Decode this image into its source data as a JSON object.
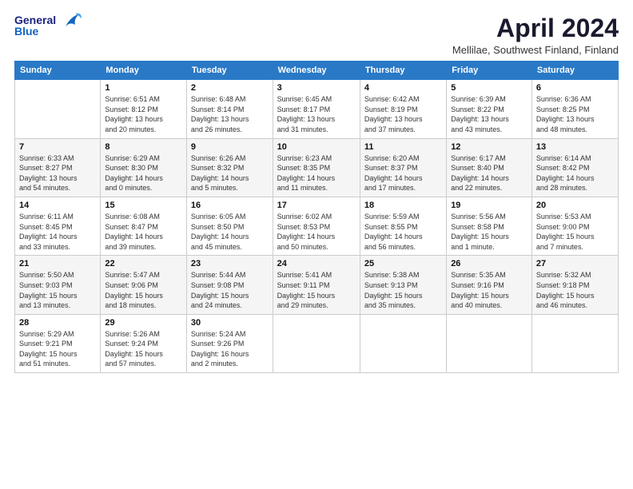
{
  "header": {
    "logo_general": "General",
    "logo_blue": "Blue",
    "month_title": "April 2024",
    "subtitle": "Mellilae, Southwest Finland, Finland"
  },
  "weekdays": [
    "Sunday",
    "Monday",
    "Tuesday",
    "Wednesday",
    "Thursday",
    "Friday",
    "Saturday"
  ],
  "weeks": [
    [
      {
        "day": "",
        "sunrise": "",
        "sunset": "",
        "daylight": ""
      },
      {
        "day": "1",
        "sunrise": "Sunrise: 6:51 AM",
        "sunset": "Sunset: 8:12 PM",
        "daylight": "Daylight: 13 hours and 20 minutes."
      },
      {
        "day": "2",
        "sunrise": "Sunrise: 6:48 AM",
        "sunset": "Sunset: 8:14 PM",
        "daylight": "Daylight: 13 hours and 26 minutes."
      },
      {
        "day": "3",
        "sunrise": "Sunrise: 6:45 AM",
        "sunset": "Sunset: 8:17 PM",
        "daylight": "Daylight: 13 hours and 31 minutes."
      },
      {
        "day": "4",
        "sunrise": "Sunrise: 6:42 AM",
        "sunset": "Sunset: 8:19 PM",
        "daylight": "Daylight: 13 hours and 37 minutes."
      },
      {
        "day": "5",
        "sunrise": "Sunrise: 6:39 AM",
        "sunset": "Sunset: 8:22 PM",
        "daylight": "Daylight: 13 hours and 43 minutes."
      },
      {
        "day": "6",
        "sunrise": "Sunrise: 6:36 AM",
        "sunset": "Sunset: 8:25 PM",
        "daylight": "Daylight: 13 hours and 48 minutes."
      }
    ],
    [
      {
        "day": "7",
        "sunrise": "Sunrise: 6:33 AM",
        "sunset": "Sunset: 8:27 PM",
        "daylight": "Daylight: 13 hours and 54 minutes."
      },
      {
        "day": "8",
        "sunrise": "Sunrise: 6:29 AM",
        "sunset": "Sunset: 8:30 PM",
        "daylight": "Daylight: 14 hours and 0 minutes."
      },
      {
        "day": "9",
        "sunrise": "Sunrise: 6:26 AM",
        "sunset": "Sunset: 8:32 PM",
        "daylight": "Daylight: 14 hours and 5 minutes."
      },
      {
        "day": "10",
        "sunrise": "Sunrise: 6:23 AM",
        "sunset": "Sunset: 8:35 PM",
        "daylight": "Daylight: 14 hours and 11 minutes."
      },
      {
        "day": "11",
        "sunrise": "Sunrise: 6:20 AM",
        "sunset": "Sunset: 8:37 PM",
        "daylight": "Daylight: 14 hours and 17 minutes."
      },
      {
        "day": "12",
        "sunrise": "Sunrise: 6:17 AM",
        "sunset": "Sunset: 8:40 PM",
        "daylight": "Daylight: 14 hours and 22 minutes."
      },
      {
        "day": "13",
        "sunrise": "Sunrise: 6:14 AM",
        "sunset": "Sunset: 8:42 PM",
        "daylight": "Daylight: 14 hours and 28 minutes."
      }
    ],
    [
      {
        "day": "14",
        "sunrise": "Sunrise: 6:11 AM",
        "sunset": "Sunset: 8:45 PM",
        "daylight": "Daylight: 14 hours and 33 minutes."
      },
      {
        "day": "15",
        "sunrise": "Sunrise: 6:08 AM",
        "sunset": "Sunset: 8:47 PM",
        "daylight": "Daylight: 14 hours and 39 minutes."
      },
      {
        "day": "16",
        "sunrise": "Sunrise: 6:05 AM",
        "sunset": "Sunset: 8:50 PM",
        "daylight": "Daylight: 14 hours and 45 minutes."
      },
      {
        "day": "17",
        "sunrise": "Sunrise: 6:02 AM",
        "sunset": "Sunset: 8:53 PM",
        "daylight": "Daylight: 14 hours and 50 minutes."
      },
      {
        "day": "18",
        "sunrise": "Sunrise: 5:59 AM",
        "sunset": "Sunset: 8:55 PM",
        "daylight": "Daylight: 14 hours and 56 minutes."
      },
      {
        "day": "19",
        "sunrise": "Sunrise: 5:56 AM",
        "sunset": "Sunset: 8:58 PM",
        "daylight": "Daylight: 15 hours and 1 minute."
      },
      {
        "day": "20",
        "sunrise": "Sunrise: 5:53 AM",
        "sunset": "Sunset: 9:00 PM",
        "daylight": "Daylight: 15 hours and 7 minutes."
      }
    ],
    [
      {
        "day": "21",
        "sunrise": "Sunrise: 5:50 AM",
        "sunset": "Sunset: 9:03 PM",
        "daylight": "Daylight: 15 hours and 13 minutes."
      },
      {
        "day": "22",
        "sunrise": "Sunrise: 5:47 AM",
        "sunset": "Sunset: 9:06 PM",
        "daylight": "Daylight: 15 hours and 18 minutes."
      },
      {
        "day": "23",
        "sunrise": "Sunrise: 5:44 AM",
        "sunset": "Sunset: 9:08 PM",
        "daylight": "Daylight: 15 hours and 24 minutes."
      },
      {
        "day": "24",
        "sunrise": "Sunrise: 5:41 AM",
        "sunset": "Sunset: 9:11 PM",
        "daylight": "Daylight: 15 hours and 29 minutes."
      },
      {
        "day": "25",
        "sunrise": "Sunrise: 5:38 AM",
        "sunset": "Sunset: 9:13 PM",
        "daylight": "Daylight: 15 hours and 35 minutes."
      },
      {
        "day": "26",
        "sunrise": "Sunrise: 5:35 AM",
        "sunset": "Sunset: 9:16 PM",
        "daylight": "Daylight: 15 hours and 40 minutes."
      },
      {
        "day": "27",
        "sunrise": "Sunrise: 5:32 AM",
        "sunset": "Sunset: 9:18 PM",
        "daylight": "Daylight: 15 hours and 46 minutes."
      }
    ],
    [
      {
        "day": "28",
        "sunrise": "Sunrise: 5:29 AM",
        "sunset": "Sunset: 9:21 PM",
        "daylight": "Daylight: 15 hours and 51 minutes."
      },
      {
        "day": "29",
        "sunrise": "Sunrise: 5:26 AM",
        "sunset": "Sunset: 9:24 PM",
        "daylight": "Daylight: 15 hours and 57 minutes."
      },
      {
        "day": "30",
        "sunrise": "Sunrise: 5:24 AM",
        "sunset": "Sunset: 9:26 PM",
        "daylight": "Daylight: 16 hours and 2 minutes."
      },
      {
        "day": "",
        "sunrise": "",
        "sunset": "",
        "daylight": ""
      },
      {
        "day": "",
        "sunrise": "",
        "sunset": "",
        "daylight": ""
      },
      {
        "day": "",
        "sunrise": "",
        "sunset": "",
        "daylight": ""
      },
      {
        "day": "",
        "sunrise": "",
        "sunset": "",
        "daylight": ""
      }
    ]
  ]
}
